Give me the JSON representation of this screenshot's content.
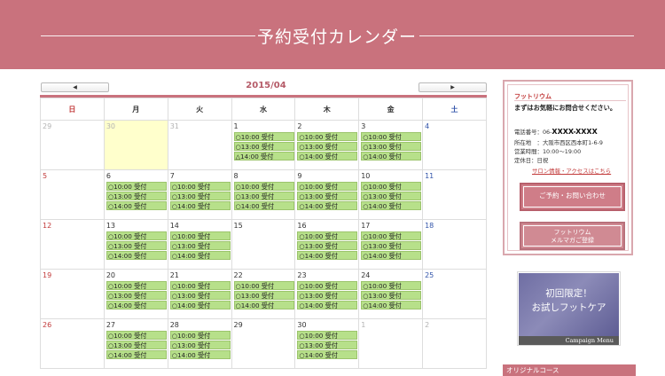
{
  "header": {
    "title": "予約受付カレンダー"
  },
  "calendar": {
    "month": "2015/04",
    "prev_label": "◀",
    "next_label": "▶",
    "weekdays": [
      "日",
      "月",
      "火",
      "水",
      "木",
      "金",
      "土"
    ],
    "weeks": [
      [
        {
          "d": "29",
          "other": true,
          "slots": []
        },
        {
          "d": "30",
          "other": true,
          "today": true,
          "slots": []
        },
        {
          "d": "31",
          "other": true,
          "slots": []
        },
        {
          "d": "1",
          "slots": [
            "○10:00 受付",
            "○13:00 受付",
            "△14:00 受付"
          ]
        },
        {
          "d": "2",
          "slots": [
            "○10:00 受付",
            "○13:00 受付",
            "○14:00 受付"
          ]
        },
        {
          "d": "3",
          "slots": [
            "○10:00 受付",
            "○13:00 受付",
            "○14:00 受付"
          ]
        },
        {
          "d": "4",
          "slots": []
        }
      ],
      [
        {
          "d": "5",
          "slots": []
        },
        {
          "d": "6",
          "slots": [
            "○10:00 受付",
            "○13:00 受付",
            "○14:00 受付"
          ]
        },
        {
          "d": "7",
          "slots": [
            "○10:00 受付",
            "○13:00 受付",
            "○14:00 受付"
          ]
        },
        {
          "d": "8",
          "slots": [
            "○10:00 受付",
            "○13:00 受付",
            "○14:00 受付"
          ]
        },
        {
          "d": "9",
          "slots": [
            "○10:00 受付",
            "○13:00 受付",
            "○14:00 受付"
          ]
        },
        {
          "d": "10",
          "slots": [
            "○10:00 受付",
            "○13:00 受付",
            "○14:00 受付"
          ]
        },
        {
          "d": "11",
          "slots": []
        }
      ],
      [
        {
          "d": "12",
          "slots": []
        },
        {
          "d": "13",
          "slots": [
            "○10:00 受付",
            "○13:00 受付",
            "○14:00 受付"
          ]
        },
        {
          "d": "14",
          "slots": [
            "○10:00 受付",
            "○13:00 受付",
            "○14:00 受付"
          ]
        },
        {
          "d": "15",
          "slots": []
        },
        {
          "d": "16",
          "slots": [
            "○10:00 受付",
            "○13:00 受付",
            "○14:00 受付"
          ]
        },
        {
          "d": "17",
          "slots": [
            "○10:00 受付",
            "○13:00 受付",
            "○14:00 受付"
          ]
        },
        {
          "d": "18",
          "slots": []
        }
      ],
      [
        {
          "d": "19",
          "slots": []
        },
        {
          "d": "20",
          "slots": [
            "○10:00 受付",
            "○13:00 受付",
            "○14:00 受付"
          ]
        },
        {
          "d": "21",
          "slots": [
            "○10:00 受付",
            "○13:00 受付",
            "○14:00 受付"
          ]
        },
        {
          "d": "22",
          "slots": [
            "○10:00 受付",
            "○13:00 受付",
            "○14:00 受付"
          ]
        },
        {
          "d": "23",
          "slots": [
            "○10:00 受付",
            "○13:00 受付",
            "○14:00 受付"
          ]
        },
        {
          "d": "24",
          "slots": [
            "○10:00 受付",
            "○13:00 受付",
            "○14:00 受付"
          ]
        },
        {
          "d": "25",
          "slots": []
        }
      ],
      [
        {
          "d": "26",
          "slots": []
        },
        {
          "d": "27",
          "slots": [
            "○10:00 受付",
            "○13:00 受付",
            "○14:00 受付"
          ]
        },
        {
          "d": "28",
          "slots": [
            "○10:00 受付",
            "○13:00 受付",
            "○14:00 受付"
          ]
        },
        {
          "d": "29",
          "slots": []
        },
        {
          "d": "30",
          "slots": [
            "○10:00 受付",
            "○13:00 受付",
            "○14:00 受付"
          ]
        },
        {
          "d": "1",
          "other": true,
          "slots": []
        },
        {
          "d": "2",
          "other": true,
          "slots": []
        }
      ]
    ]
  },
  "sidebar": {
    "shop_name": "フットリウム",
    "intro": "まずはお気軽にお問合せください。",
    "tel_label": "電話番号：06-",
    "tel_num": "XXXX-XXXX",
    "address": "所在地　：大阪市西区西本町1-6-9",
    "hours": "営業時間：10:00～19:00",
    "closed": "定休日：日祝",
    "salon_link": "サロン情報・アクセスはこちら",
    "reserve_button": "ご予約・お問い合わせ",
    "magazine_line1": "フットリウム",
    "magazine_line2": "メルマガご登録",
    "campaign_line1": "初回限定！",
    "campaign_line2": "お試しフットケア",
    "campaign_caption": "Campaign Menu",
    "original_course": "オリジナルコース"
  },
  "colors": {
    "brand": "#c9727d",
    "slot_bg": "#b7e08a",
    "today_bg": "#ffffcc",
    "sunday": "#c23a3a",
    "saturday": "#3355aa"
  }
}
